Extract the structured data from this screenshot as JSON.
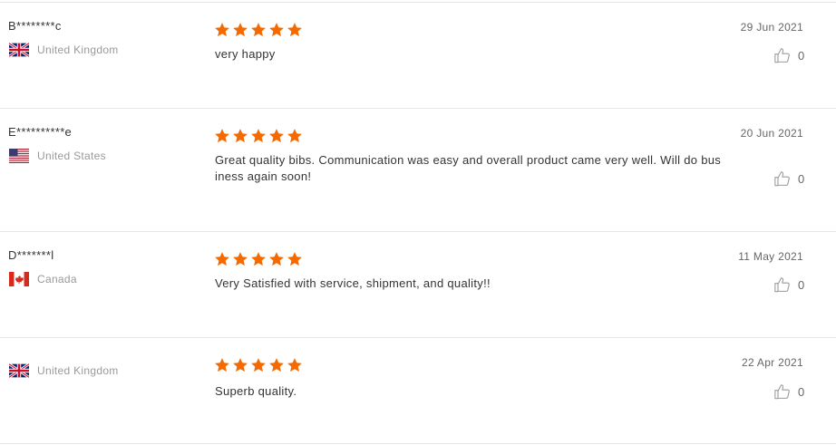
{
  "colors": {
    "star": "#f56a00",
    "divider": "#e6e6e6",
    "country_text": "#999999",
    "icon": "#999999"
  },
  "reviews": [
    {
      "reviewer": "B********c",
      "country": "United Kingdom",
      "flag_icon": "uk-flag-icon",
      "rating": 5,
      "text": "very happy",
      "date": "29 Jun 2021",
      "helpful_count": "0"
    },
    {
      "reviewer": "E**********e",
      "country": "United States",
      "flag_icon": "us-flag-icon",
      "rating": 5,
      "text": "Great quality bibs. Communication was easy and overall product came very well. Will do business again soon!",
      "date": "20 Jun 2021",
      "helpful_count": "0"
    },
    {
      "reviewer": "D*******l",
      "country": "Canada",
      "flag_icon": "canada-flag-icon",
      "rating": 5,
      "text": "Very Satisfied with service, shipment, and quality!!",
      "date": "11 May 2021",
      "helpful_count": "0"
    },
    {
      "reviewer": "",
      "country": "United Kingdom",
      "flag_icon": "uk-flag-icon",
      "rating": 5,
      "text": "Superb quality.",
      "date": "22 Apr 2021",
      "helpful_count": "0"
    }
  ]
}
